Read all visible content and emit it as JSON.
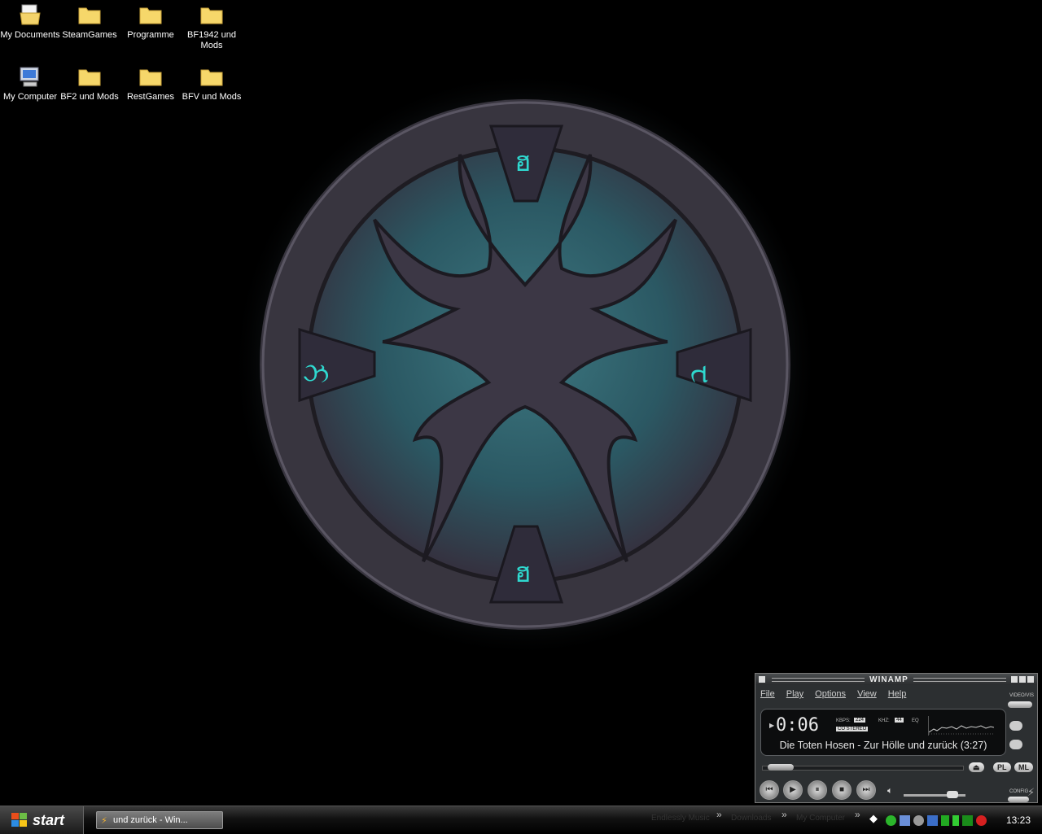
{
  "desktop": {
    "icons": [
      {
        "label": "My Documents",
        "icon": "my-documents-icon"
      },
      {
        "label": "SteamGames",
        "icon": "folder-icon"
      },
      {
        "label": "Programme",
        "icon": "folder-icon"
      },
      {
        "label": "BF1942 und Mods",
        "icon": "folder-icon"
      },
      {
        "label": "My Computer",
        "icon": "my-computer-icon"
      },
      {
        "label": "BF2 und Mods",
        "icon": "folder-icon"
      },
      {
        "label": "RestGames",
        "icon": "folder-icon"
      },
      {
        "label": "BFV und Mods",
        "icon": "folder-icon"
      }
    ]
  },
  "taskbar": {
    "start_label": "start",
    "task_button_label": "und zurück - Win...",
    "quick_links": [
      "Endlessly Music",
      "Downloads",
      "My Computer"
    ],
    "clock": "13:23"
  },
  "winamp": {
    "title": "WINAMP",
    "menu": [
      "File",
      "Play",
      "Options",
      "View",
      "Help"
    ],
    "time": "0:06",
    "kbps_label": "KBPS:",
    "kbps": "224",
    "khz_label": "KHZ:",
    "khz": "44",
    "eq_label": "EQ",
    "stereo": "CO STEREO",
    "track": "Die Toten Hosen - Zur Hölle und zurück (3:27)",
    "seek_fraction": 0.03,
    "volume_fraction": 0.85,
    "pl_label": "PL",
    "ml_label": "ML",
    "video_vis_label": "VIDEO/VIS",
    "config_label": "CONFIG"
  },
  "colors": {
    "emblem_teal": "#2a6a74",
    "emblem_dark": "#2f2b34",
    "rune_cyan": "#2fd8cf"
  }
}
